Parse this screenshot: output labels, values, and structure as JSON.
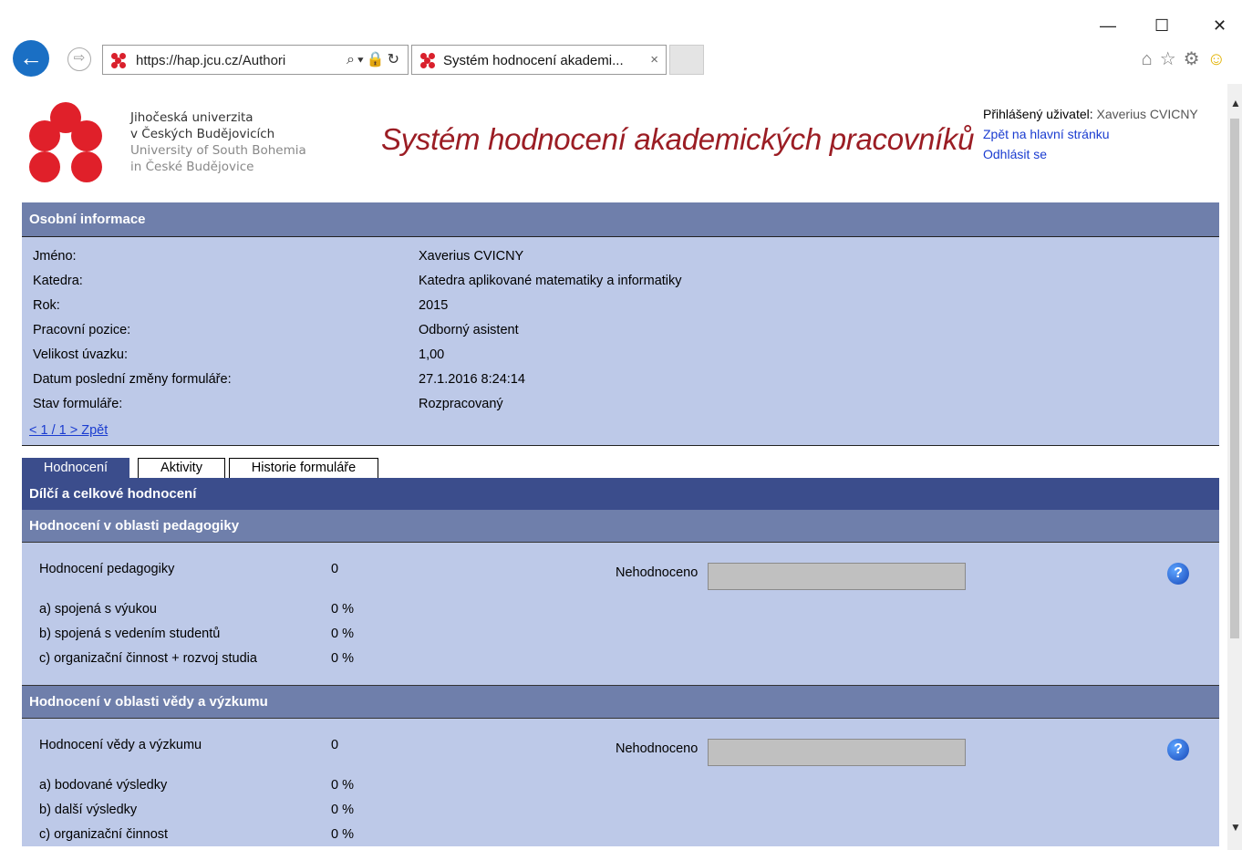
{
  "browser": {
    "url": "https://hap.jcu.cz/Authori",
    "tab_title": "Systém hodnocení akademi...",
    "tab_close": "×",
    "window_controls": {
      "minimize": "—",
      "maximize": "☐",
      "close": "✕"
    },
    "toolbar_icons": [
      "home-icon",
      "star-icon",
      "gear-icon",
      "smiley-icon"
    ]
  },
  "header": {
    "university_cz_1": "Jihočeská univerzita",
    "university_cz_2": "v Českých Budějovicích",
    "university_en_1": "University of South Bohemia",
    "university_en_2": "in České Budějovice",
    "app_title": "Systém hodnocení akademických pracovníků",
    "user_label": "Přihlášený uživatel:",
    "user_name": "Xaverius CVICNY",
    "back_link": "Zpět na hlavní stránku",
    "logout_link": "Odhlásit se"
  },
  "personal": {
    "section_title": "Osobní informace",
    "rows": [
      {
        "label": "Jméno:",
        "value": "Xaverius CVICNY"
      },
      {
        "label": "Katedra:",
        "value": "Katedra aplikované matematiky a informatiky"
      },
      {
        "label": "Rok:",
        "value": "2015"
      },
      {
        "label": "Pracovní pozice:",
        "value": "Odborný asistent"
      },
      {
        "label": "Velikost úvazku:",
        "value": "1,00"
      },
      {
        "label": "Datum poslední změny formuláře:",
        "value": "27.1.2016 8:24:14"
      },
      {
        "label": "Stav formuláře:",
        "value": "Rozpracovaný"
      }
    ],
    "pager": "< 1 / 1 > Zpět"
  },
  "tabs": [
    "Hodnocení",
    "Aktivity",
    "Historie formuláře"
  ],
  "evaluation": {
    "title": "Dílčí a celkové hodnocení",
    "sections": [
      {
        "title": "Hodnocení v oblasti pedagogiky",
        "main_label": "Hodnocení pedagogiky",
        "main_value": "0",
        "status_label": "Nehodnoceno",
        "items": [
          {
            "label": "a) spojená s výukou",
            "value": "0 %"
          },
          {
            "label": "b) spojená s vedením studentů",
            "value": "0 %"
          },
          {
            "label": "c) organizační činnost + rozvoj studia",
            "value": "0 %"
          }
        ]
      },
      {
        "title": "Hodnocení v oblasti vědy a výzkumu",
        "main_label": "Hodnocení vědy a výzkumu",
        "main_value": "0",
        "status_label": "Nehodnoceno",
        "items": [
          {
            "label": "a) bodované výsledky",
            "value": "0 %"
          },
          {
            "label": "b) další výsledky",
            "value": "0 %"
          },
          {
            "label": "c) organizační činnost",
            "value": "0 %"
          }
        ]
      }
    ],
    "help_glyph": "?"
  }
}
